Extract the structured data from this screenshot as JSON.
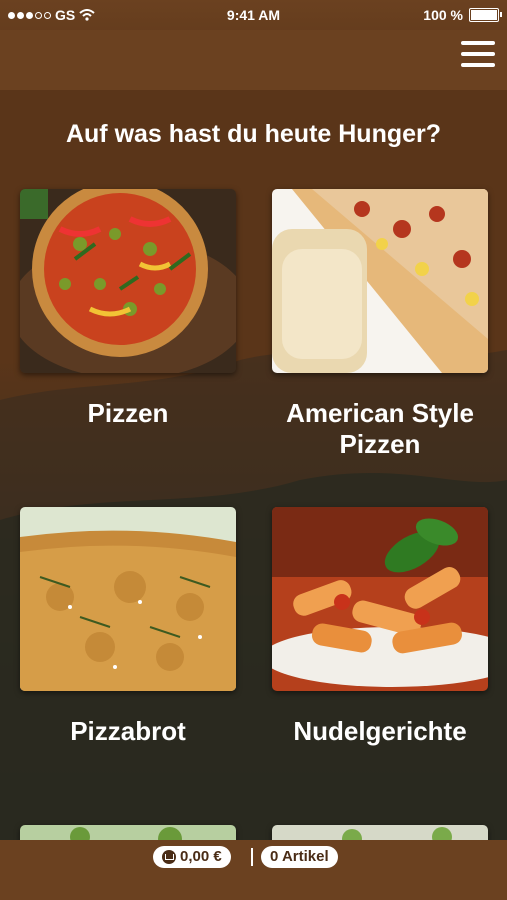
{
  "status_bar": {
    "carrier": "GS",
    "time": "9:41 AM",
    "battery": "100 %"
  },
  "header": {
    "menu_icon": "hamburger-menu-icon"
  },
  "headline": "Auf was hast du heute Hunger?",
  "categories": [
    {
      "label": "Pizzen"
    },
    {
      "label": "American Style\nPizzen"
    },
    {
      "label": "Pizzabrot"
    },
    {
      "label": "Nudelgerichte"
    }
  ],
  "cart": {
    "total": "0,00 €",
    "items": "0 Artikel",
    "icon": "cart-icon"
  },
  "colors": {
    "brand_brown": "#6b4120",
    "text": "#ffffff"
  }
}
